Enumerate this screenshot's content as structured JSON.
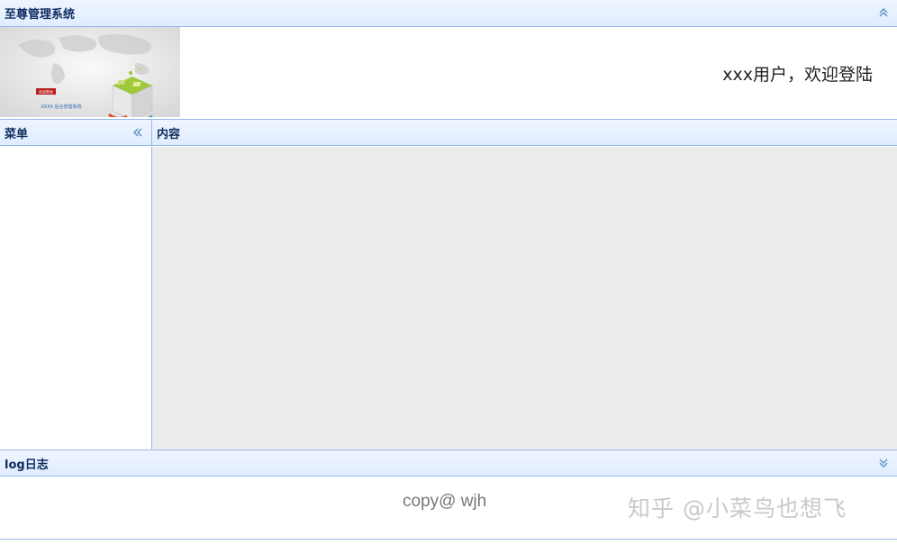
{
  "north": {
    "title": "至尊管理系统",
    "collapse_icon": "double-chevron-up-icon"
  },
  "banner": {
    "badge_text": "欢迎登录",
    "system_name": "XXXX 后台管理系统"
  },
  "header": {
    "welcome": "xxx用户，欢迎登陆"
  },
  "west": {
    "title": "菜单",
    "collapse_icon": "double-chevron-left-icon"
  },
  "center": {
    "title": "内容"
  },
  "south": {
    "title": "log日志",
    "collapse_icon": "double-chevron-down-icon",
    "copyright": "copy@ wjh"
  },
  "watermark": "知乎 @小菜鸟也想飞",
  "colors": {
    "header_gradient_top": "#eff5ff",
    "header_gradient_bottom": "#e0ecff",
    "border": "#95b8e7",
    "title_text": "#0e2d5f",
    "content_bg": "#ececec"
  }
}
